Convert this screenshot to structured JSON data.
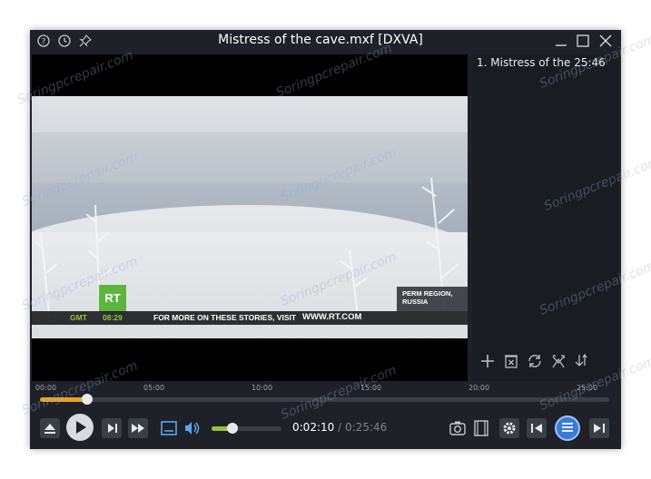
{
  "window": {
    "title": "Mistress of the cave.mxf [DXVA]",
    "icons": [
      "help-icon",
      "clock-icon",
      "pin-icon"
    ],
    "window_buttons": [
      "minimize-icon",
      "maximize-icon",
      "close-icon"
    ]
  },
  "video": {
    "channel_logo": "RT",
    "ticker_left": "GMT",
    "ticker_time": "08:29",
    "ticker_text": "FOR MORE ON THESE STORIES, VISIT",
    "ticker_url": "WWW.RT.COM",
    "region_line1": "PERM REGION,",
    "region_line2": "RUSSIA"
  },
  "playlist": {
    "items": [
      {
        "label": "1. Mistress of the",
        "duration": "25:46"
      }
    ],
    "tools": [
      "add-icon",
      "delete-icon",
      "repeat-icon",
      "shuffle-icon",
      "sort-icon"
    ]
  },
  "timeline": {
    "ticks": [
      "00:00",
      "05:00",
      "10:00",
      "15:00",
      "20:00",
      "25:00"
    ],
    "progress": 0.083
  },
  "controls": {
    "current_time": "0:02:10",
    "separator": "/",
    "total_time": "0:25:46",
    "volume": 0.3
  },
  "watermark": "Soringpcrepair.com",
  "colors": {
    "accent": "#e8a51c",
    "volume": "#8ec63f",
    "window_bg": "#1e2127",
    "playlist_selected": "#3a7bd5"
  }
}
